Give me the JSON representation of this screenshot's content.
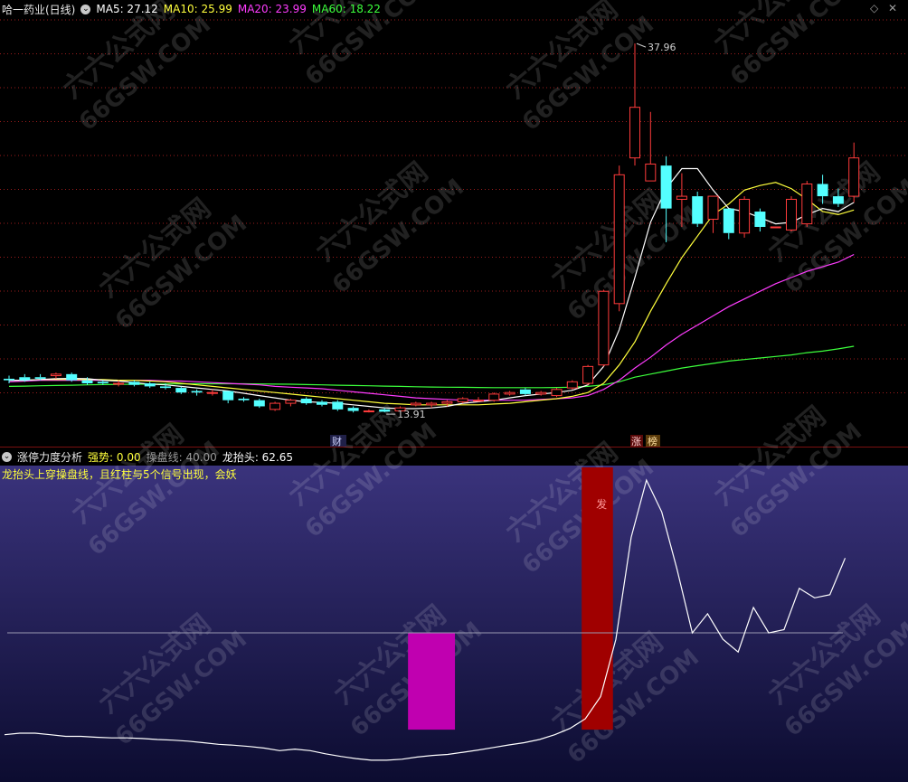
{
  "top_header": {
    "title": "哈一药业(日线)",
    "ma5": "MA5: 27.12",
    "ma10": "MA10: 25.99",
    "ma20": "MA20: 23.99",
    "ma60": "MA60: 18.22"
  },
  "bottom_header": {
    "name": "涨停力度分析",
    "strength": "强势: 0.00",
    "base": "操盘线: 40.00",
    "dragon": "龙抬头: 62.65"
  },
  "hint": "龙抬头上穿操盘线，且红柱与5个信号出现，会妖",
  "markers": {
    "cai": "财",
    "zhang": "涨",
    "bang": "榜",
    "fa": "发"
  },
  "watermark": [
    "六六公式网",
    "66GSW.COM"
  ],
  "colors": {
    "up": "#ff3b3b",
    "down": "#54ffff",
    "ma5": "#ffffff",
    "ma10": "#ffff3c",
    "ma20": "#ff3cff",
    "ma60": "#3cff3c",
    "grid": "#9c1c1c",
    "magenta_bar": "#c000b0",
    "red_bar": "#a00000"
  },
  "chart_data": [
    {
      "type": "candlestick",
      "title": "哈一药业(日线)",
      "ylim": [
        12.5,
        39.5
      ],
      "annotations": [
        {
          "label": "37.96",
          "index": 40,
          "value": 37.96
        },
        {
          "label": "13.91",
          "index": 24,
          "value": 13.91
        }
      ],
      "series_ohlc": [
        [
          16.1,
          16.3,
          15.8,
          16.0
        ],
        [
          16.2,
          16.4,
          15.9,
          16.0
        ],
        [
          16.2,
          16.4,
          16.0,
          16.1
        ],
        [
          16.3,
          16.5,
          16.1,
          16.4
        ],
        [
          16.4,
          16.5,
          15.9,
          16.0
        ],
        [
          16.0,
          16.2,
          15.7,
          15.8
        ],
        [
          15.9,
          16.0,
          15.7,
          15.8
        ],
        [
          15.8,
          16.0,
          15.6,
          15.8
        ],
        [
          15.9,
          16.0,
          15.6,
          15.7
        ],
        [
          15.8,
          15.9,
          15.5,
          15.6
        ],
        [
          15.6,
          15.8,
          15.4,
          15.5
        ],
        [
          15.5,
          15.6,
          15.1,
          15.2
        ],
        [
          15.3,
          15.4,
          15.0,
          15.2
        ],
        [
          15.2,
          15.4,
          15.0,
          15.2
        ],
        [
          15.3,
          15.3,
          14.5,
          14.7
        ],
        [
          14.8,
          14.9,
          14.6,
          14.7
        ],
        [
          14.7,
          14.8,
          14.2,
          14.3
        ],
        [
          14.1,
          14.6,
          14.0,
          14.5
        ],
        [
          14.5,
          14.8,
          14.3,
          14.7
        ],
        [
          14.8,
          14.9,
          14.4,
          14.5
        ],
        [
          14.6,
          14.7,
          14.3,
          14.4
        ],
        [
          14.6,
          14.7,
          14.0,
          14.1
        ],
        [
          14.2,
          14.3,
          13.9,
          14.0
        ],
        [
          14.0,
          14.1,
          13.9,
          14.0
        ],
        [
          14.1,
          14.2,
          13.91,
          13.95
        ],
        [
          14.0,
          14.3,
          14.0,
          14.2
        ],
        [
          14.4,
          14.6,
          14.3,
          14.5
        ],
        [
          14.4,
          14.6,
          14.2,
          14.5
        ],
        [
          14.5,
          14.7,
          14.3,
          14.6
        ],
        [
          14.6,
          14.9,
          14.5,
          14.8
        ],
        [
          14.7,
          14.9,
          14.6,
          14.7
        ],
        [
          14.7,
          15.2,
          14.6,
          15.1
        ],
        [
          15.1,
          15.3,
          15.0,
          15.2
        ],
        [
          15.4,
          15.5,
          15.0,
          15.1
        ],
        [
          15.1,
          15.3,
          15.0,
          15.2
        ],
        [
          15.0,
          15.5,
          14.9,
          15.4
        ],
        [
          15.5,
          16.0,
          15.4,
          15.9
        ],
        [
          15.8,
          17.0,
          15.7,
          16.9
        ],
        [
          17.0,
          21.9,
          16.9,
          21.8
        ],
        [
          21.0,
          30.0,
          20.5,
          29.4
        ],
        [
          30.5,
          37.96,
          30.0,
          33.8
        ],
        [
          29.0,
          33.5,
          29.0,
          30.1
        ],
        [
          30.0,
          30.6,
          25.0,
          27.2
        ],
        [
          27.8,
          29.5,
          26.0,
          28.0
        ],
        [
          28.0,
          28.3,
          26.0,
          26.2
        ],
        [
          26.5,
          28.0,
          25.6,
          28.0
        ],
        [
          27.2,
          27.2,
          25.2,
          25.6
        ],
        [
          25.6,
          28.0,
          25.3,
          27.8
        ],
        [
          27.0,
          27.2,
          25.7,
          26.0
        ],
        [
          26.0,
          26.0,
          26.0,
          26.0
        ],
        [
          25.8,
          28.0,
          25.7,
          27.8
        ],
        [
          26.2,
          29.0,
          26.0,
          28.8
        ],
        [
          28.8,
          29.4,
          27.5,
          28.0
        ],
        [
          28.0,
          28.5,
          27.3,
          27.5
        ],
        [
          28.0,
          31.5,
          27.6,
          30.5
        ]
      ],
      "ma5": [
        16.0,
        16.0,
        16.05,
        16.1,
        16.12,
        16.1,
        16.0,
        15.95,
        15.85,
        15.75,
        15.7,
        15.6,
        15.5,
        15.4,
        15.3,
        15.15,
        15.0,
        14.85,
        14.7,
        14.6,
        14.55,
        14.5,
        14.4,
        14.3,
        14.2,
        14.15,
        14.15,
        14.2,
        14.3,
        14.5,
        14.6,
        14.7,
        14.85,
        15.0,
        15.1,
        15.2,
        15.35,
        15.7,
        16.9,
        19.3,
        22.7,
        26.3,
        28.5,
        29.8,
        29.8,
        28.4,
        27.2,
        27.0,
        26.6,
        26.2,
        26.3,
        26.8,
        27.2,
        27.0,
        27.6
      ],
      "ma10": [
        16.0,
        16.0,
        16.05,
        16.05,
        16.05,
        16.05,
        16.05,
        16.0,
        16.0,
        15.95,
        15.9,
        15.8,
        15.7,
        15.6,
        15.5,
        15.4,
        15.3,
        15.2,
        15.1,
        15.0,
        14.9,
        14.8,
        14.7,
        14.6,
        14.5,
        14.45,
        14.4,
        14.4,
        14.4,
        14.4,
        14.4,
        14.45,
        14.5,
        14.6,
        14.7,
        14.8,
        14.95,
        15.2,
        15.8,
        17.0,
        18.5,
        20.5,
        22.3,
        24.0,
        25.4,
        26.8,
        27.5,
        28.4,
        28.7,
        28.9,
        28.5,
        27.8,
        27.0,
        26.8,
        27.1
      ],
      "ma20": [
        15.9,
        15.95,
        16.0,
        16.0,
        16.0,
        16.0,
        16.0,
        16.0,
        16.0,
        16.0,
        15.95,
        15.95,
        15.9,
        15.85,
        15.8,
        15.75,
        15.7,
        15.6,
        15.55,
        15.5,
        15.45,
        15.35,
        15.25,
        15.15,
        15.05,
        14.95,
        14.85,
        14.8,
        14.75,
        14.7,
        14.7,
        14.7,
        14.7,
        14.7,
        14.75,
        14.8,
        14.85,
        15.0,
        15.4,
        16.0,
        16.8,
        17.5,
        18.3,
        19.0,
        19.6,
        20.2,
        20.8,
        21.3,
        21.8,
        22.3,
        22.7,
        23.1,
        23.4,
        23.7,
        24.2
      ],
      "ma60": [
        15.6,
        15.62,
        15.64,
        15.66,
        15.68,
        15.7,
        15.72,
        15.73,
        15.74,
        15.75,
        15.76,
        15.76,
        15.77,
        15.77,
        15.77,
        15.77,
        15.76,
        15.75,
        15.74,
        15.72,
        15.7,
        15.68,
        15.66,
        15.64,
        15.62,
        15.6,
        15.58,
        15.56,
        15.55,
        15.54,
        15.53,
        15.52,
        15.52,
        15.52,
        15.52,
        15.53,
        15.55,
        15.6,
        15.7,
        15.9,
        16.2,
        16.4,
        16.6,
        16.8,
        16.95,
        17.1,
        17.25,
        17.35,
        17.45,
        17.55,
        17.65,
        17.8,
        17.9,
        18.05,
        18.22
      ]
    },
    {
      "type": "line",
      "title": "涨停力度分析",
      "ylim": [
        -6,
        92
      ],
      "reference_line": 40,
      "dragon": [
        8,
        8.5,
        8.5,
        8,
        7.5,
        7.5,
        7.2,
        7.0,
        7.0,
        6.8,
        6.5,
        6.3,
        6.0,
        5.5,
        5.0,
        4.7,
        4.3,
        3.8,
        3.0,
        3.5,
        3.0,
        2.0,
        1.2,
        0.5,
        0.0,
        0.0,
        0.3,
        1.0,
        1.5,
        1.8,
        2.5,
        3.2,
        4.0,
        4.8,
        5.5,
        6.5,
        8.0,
        10.0,
        13.0,
        20.0,
        38.0,
        70.0,
        88.0,
        78.0,
        60.0,
        40.0,
        46.0,
        38.0,
        34.0,
        48.0,
        40.0,
        41.0,
        54.0,
        51.0,
        52.0,
        63.5
      ],
      "magenta_bar": {
        "from": 25.5,
        "to": 28.5,
        "low": 9.6,
        "high": 40.0
      },
      "red_bar": {
        "from": 36.6,
        "to": 38.6,
        "low": 9.6,
        "high": 92.0
      }
    }
  ]
}
